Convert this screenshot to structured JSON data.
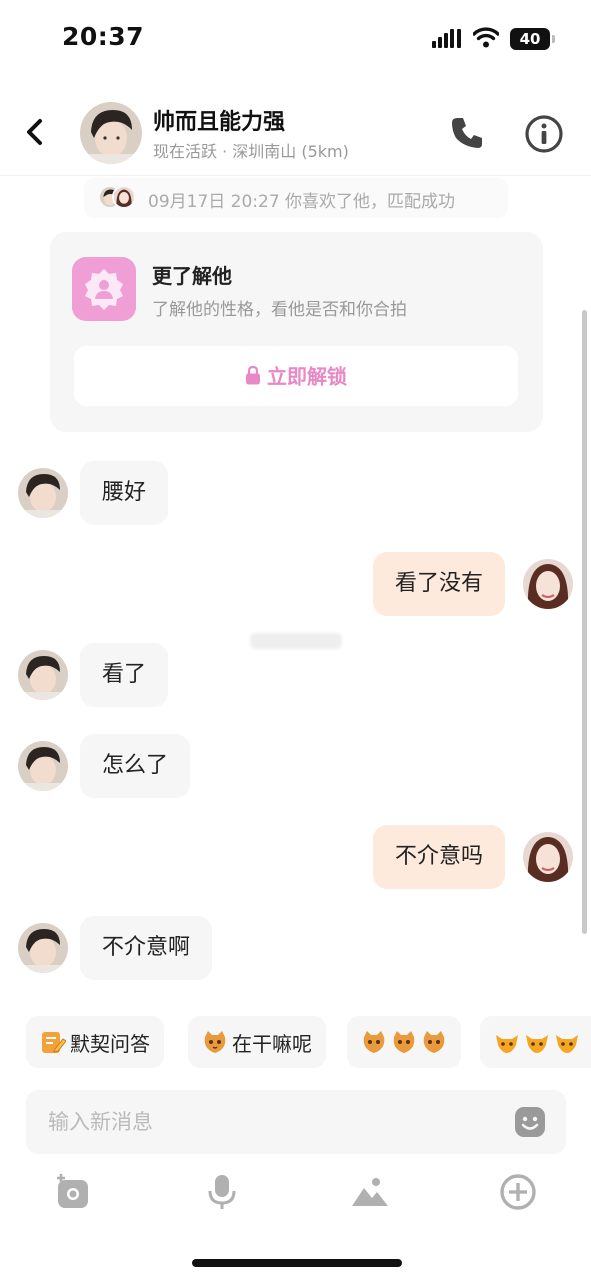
{
  "status_bar": {
    "time": "20:37",
    "battery": "40"
  },
  "header": {
    "contact_name": "帅而且能力强",
    "contact_status": "现在活跃 · 深圳南山 (5km)"
  },
  "match_banner": {
    "text": "09月17日 20:27 你喜欢了他，匹配成功"
  },
  "know_card": {
    "title": "更了解他",
    "subtitle": "了解他的性格，看他是否和你合拍",
    "unlock_label": "立即解锁"
  },
  "messages": [
    {
      "from": "him",
      "text": "腰好"
    },
    {
      "from": "me",
      "text": "看了没有"
    },
    {
      "from": "him",
      "text": "看了"
    },
    {
      "from": "him",
      "text": "怎么了"
    },
    {
      "from": "me",
      "text": "不介意吗"
    },
    {
      "from": "him",
      "text": "不介意啊"
    }
  ],
  "quick_replies": [
    {
      "label": "默契问答",
      "icon": "pencil-note-icon"
    },
    {
      "label": "在干嘛呢",
      "icon": "cat-sticker-icon"
    },
    {
      "label": "",
      "icon": "cat-sticker-icon"
    },
    {
      "label": "",
      "icon": "fox-sticker-icon"
    }
  ],
  "input": {
    "placeholder": "输入新消息",
    "value": ""
  },
  "toolbar": [
    "camera-icon",
    "microphone-icon",
    "image-icon",
    "plus-circle-icon"
  ],
  "colors": {
    "accent_pink": "#e889c6",
    "outgoing_bubble": "#fdeadd",
    "incoming_bubble": "#f6f6f6"
  }
}
